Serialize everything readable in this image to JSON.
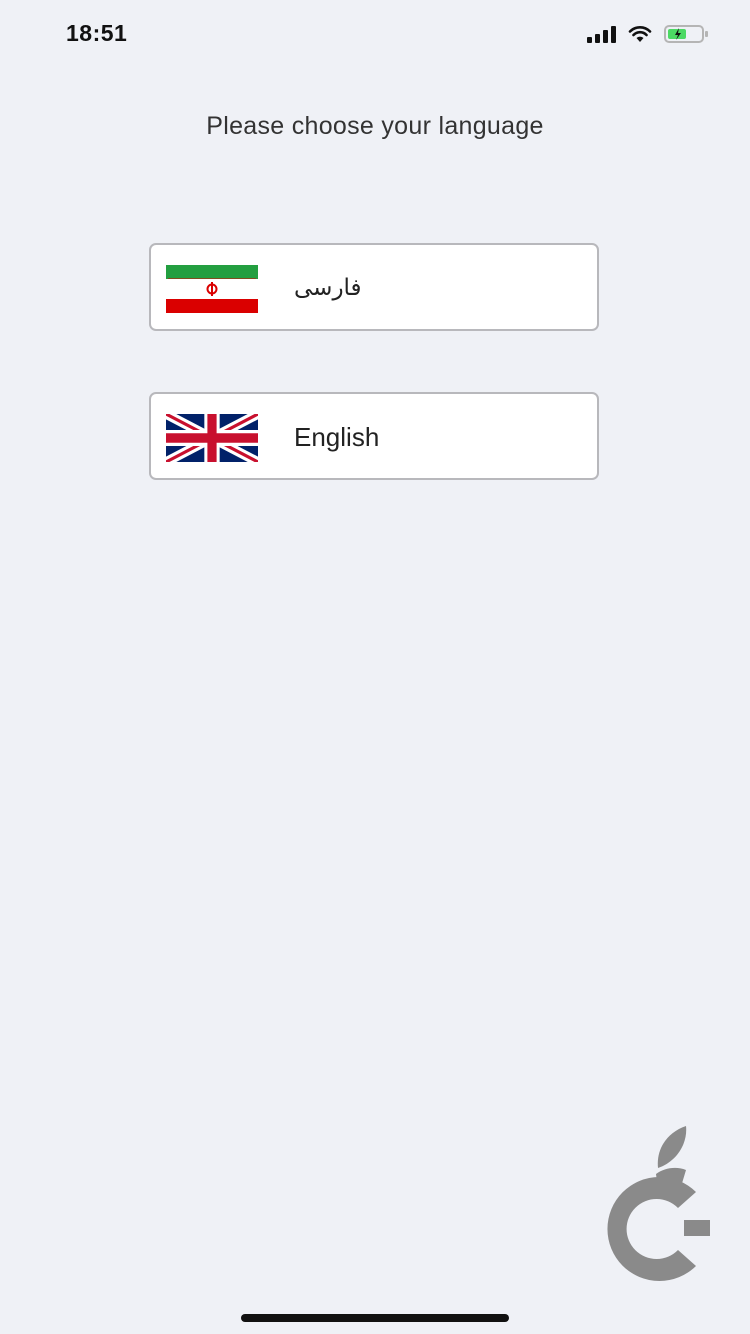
{
  "status_bar": {
    "time": "18:51",
    "icons": [
      "cellular-signal-icon",
      "wifi-icon",
      "battery-charging-icon"
    ]
  },
  "page": {
    "title": "Please choose your language"
  },
  "languages": [
    {
      "label": "فارسی",
      "flag": "iran-flag-icon"
    },
    {
      "label": "English",
      "flag": "uk-flag-icon"
    }
  ],
  "colors": {
    "background": "#eff1f6",
    "button_border": "#b8b8bc",
    "battery_fill": "#4cd964",
    "watermark": "#8a8a8a"
  }
}
